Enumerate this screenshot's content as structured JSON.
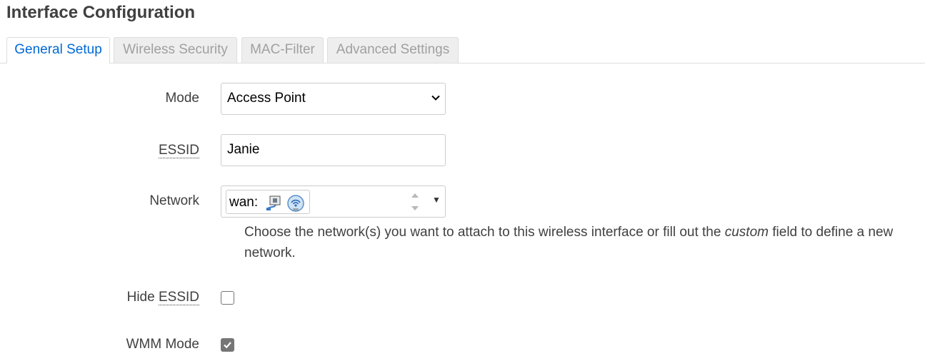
{
  "page": {
    "title": "Interface Configuration"
  },
  "tabs": [
    {
      "label": "General Setup",
      "active": true
    },
    {
      "label": "Wireless Security",
      "active": false
    },
    {
      "label": "MAC-Filter",
      "active": false
    },
    {
      "label": "Advanced Settings",
      "active": false
    }
  ],
  "form": {
    "mode": {
      "label": "Mode",
      "value": "Access Point"
    },
    "essid": {
      "label": "ESSID",
      "value": "Janie"
    },
    "network": {
      "label": "Network",
      "value": "wan:",
      "icons": [
        "network-port-icon",
        "wifi-network-icon"
      ],
      "help_before": "Choose the network(s) you want to attach to this wireless interface or fill out the ",
      "help_em": "custom",
      "help_after": " field to define a new network."
    },
    "hide_essid": {
      "label_prefix": "Hide ",
      "label_abbr": "ESSID",
      "checked": false
    },
    "wmm_mode": {
      "label": "WMM Mode",
      "checked": true
    }
  }
}
